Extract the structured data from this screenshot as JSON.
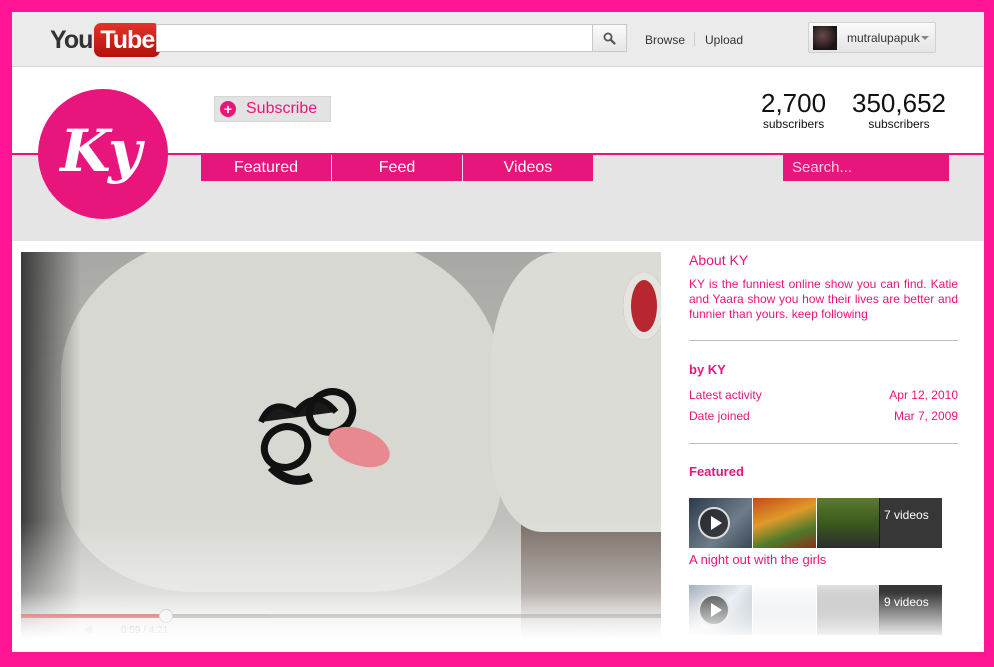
{
  "masthead": {
    "logo_you": "You",
    "logo_tube": "Tube",
    "search_placeholder": "",
    "browse_label": "Browse",
    "upload_label": "Upload",
    "username": "mutralupapuk"
  },
  "channel": {
    "logo_text": "Ky",
    "subscribe_label": "Subscribe",
    "stats": [
      {
        "value": "2,700",
        "label": "subscribers"
      },
      {
        "value": "350,652",
        "label": "subscribers"
      }
    ],
    "tabs": [
      {
        "label": "Featured"
      },
      {
        "label": "Feed"
      },
      {
        "label": "Videos"
      }
    ],
    "search_placeholder": "Search...",
    "accent_color": "#e8157c"
  },
  "player": {
    "current_time": "0:59",
    "duration": "4:21",
    "progress_fraction": 0.226
  },
  "sidebar": {
    "about_title": "About KY",
    "about_text": "KY is the funniest online show you can find. Katie and Yaara show you how their lives are better and funnier than yours. keep following",
    "by_title": "by KY",
    "latest_activity_label": "Latest activity",
    "latest_activity_value": "Apr 12, 2010",
    "date_joined_label": "Date joined",
    "date_joined_value": "Mar 7, 2009",
    "featured_title": "Featured",
    "playlists": [
      {
        "title": "A night out with the girls",
        "count": "7 videos"
      },
      {
        "title": "",
        "count": "9 videos"
      }
    ]
  }
}
